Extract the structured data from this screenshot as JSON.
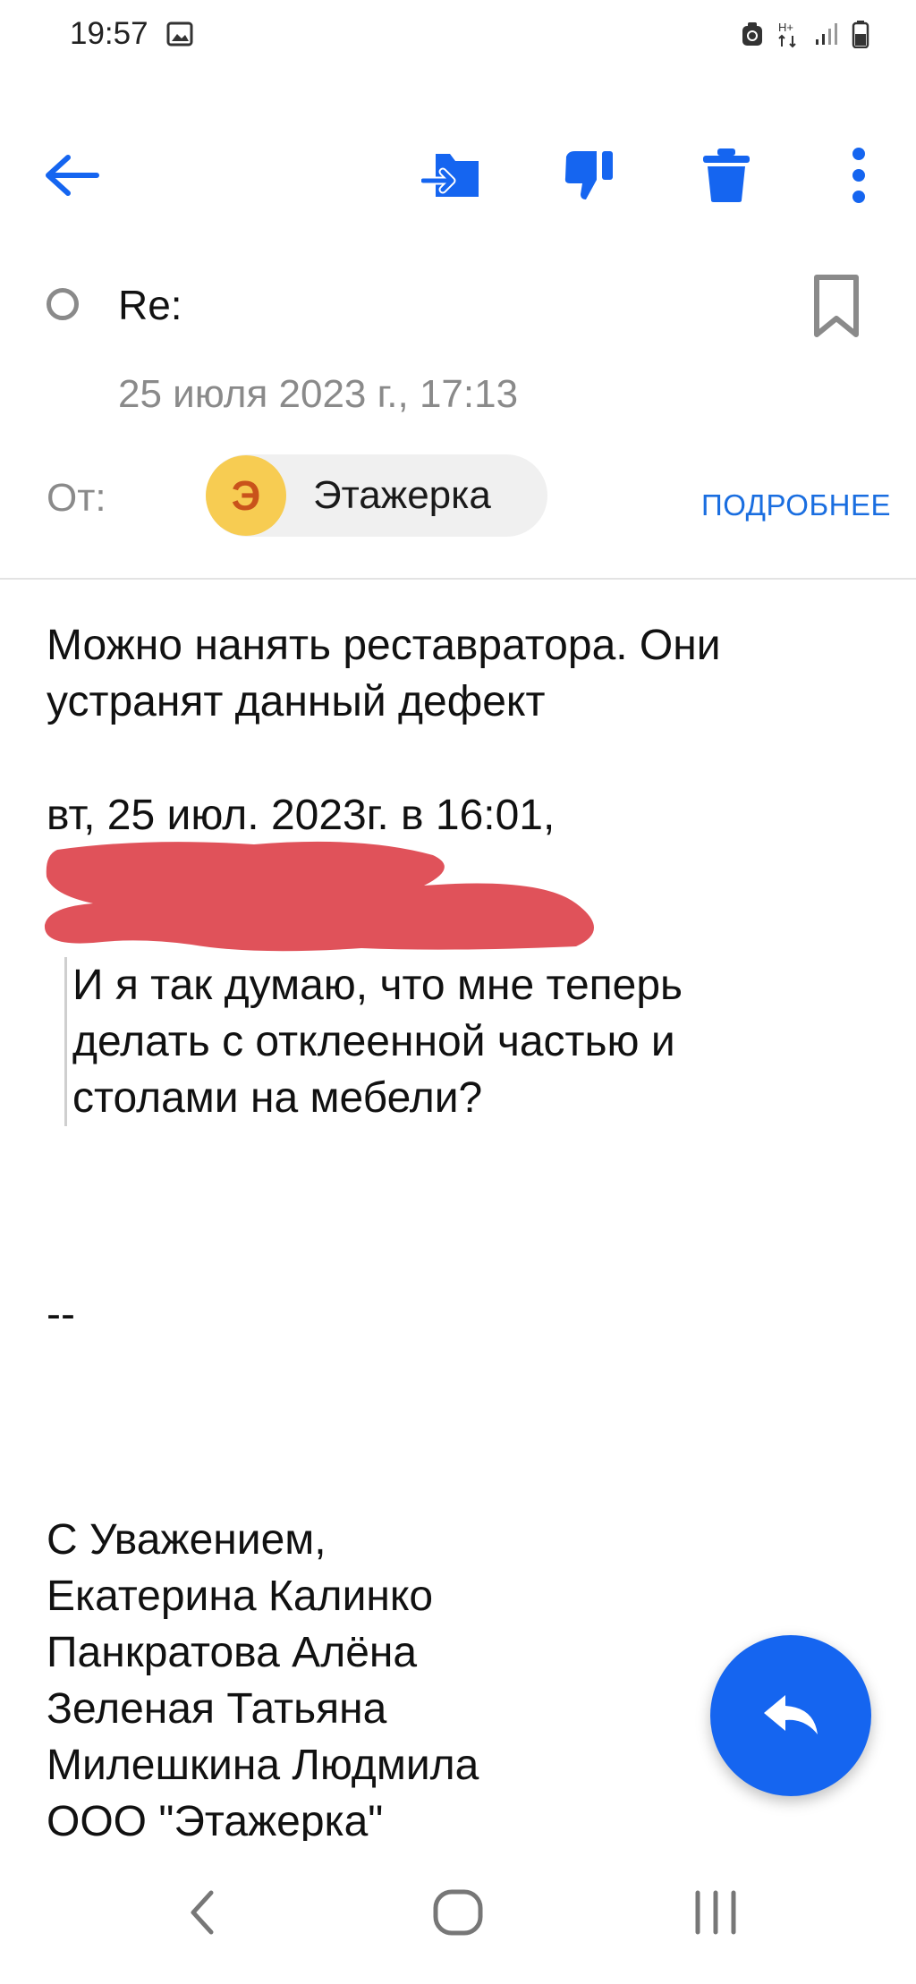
{
  "status_bar": {
    "time": "19:57"
  },
  "toolbar": {
    "icons": [
      "arrow-left-icon",
      "move-to-folder-icon",
      "thumbs-down-icon",
      "trash-icon",
      "more-vertical-icon"
    ]
  },
  "header": {
    "subject": "Re:",
    "date": "25 июля 2023 г., 17:13",
    "from_label": "От:",
    "sender_initial": "Э",
    "sender_name": "Этажерка",
    "details_label": "ПОДРОБНЕЕ"
  },
  "body": {
    "paragraph_lines": [
      "Можно нанять реставратора. Они",
      "устранят данный дефект"
    ],
    "quote_header": "вт, 25 июл. 2023г. в 16:01,",
    "quote_lines": [
      "И я так думаю, что мне теперь",
      "делать с отклеенной частью и",
      "столами на мебели?"
    ],
    "signature_separator": "--",
    "signature_lines": [
      "С Уважением,",
      "Екатерина Калинко",
      "Панкратова Алёна",
      "Зеленая Татьяна",
      "Милешкина Людмила",
      "ООО \"Этажерка\""
    ]
  },
  "colors": {
    "accent": "#1565f0",
    "link": "#1a6ee0",
    "avatar_bg": "#f7cc52",
    "avatar_text": "#c9531b",
    "redaction": "#e0525a"
  }
}
